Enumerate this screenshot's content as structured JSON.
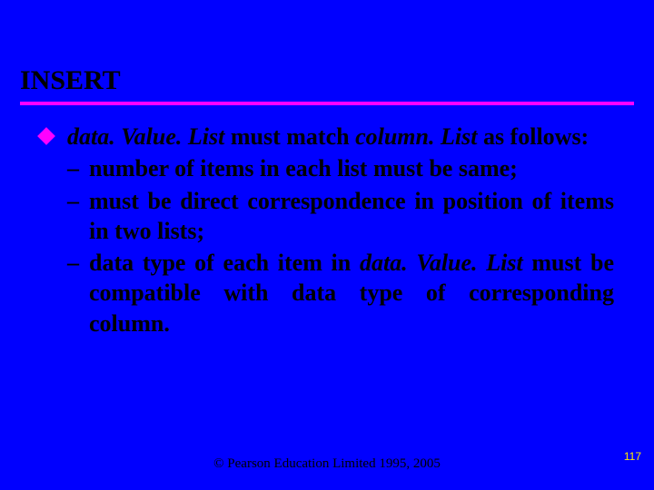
{
  "title": "INSERT",
  "lead": {
    "term1": "data. Value. List",
    "mid": " must match ",
    "term2": "column. List",
    "tail": " as follows:"
  },
  "subitems": [
    "number of items in each list must be same;",
    "must be direct correspondence in position of items in two lists;"
  ],
  "sub3": {
    "pre": "data type of each item in ",
    "term": "data. Value. List",
    "post": " must be compatible with data type of corresponding column."
  },
  "footer": "© Pearson Education Limited 1995, 2005",
  "page": "117"
}
